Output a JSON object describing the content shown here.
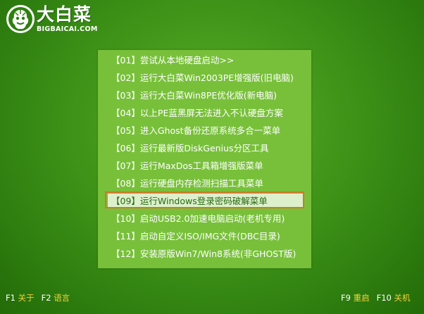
{
  "logo": {
    "name_cn": "大白菜",
    "name_en": "BIGBAICAI.COM",
    "icon": "cabbage-icon"
  },
  "menu": {
    "selected_index": 8,
    "items": [
      {
        "label": "【01】尝试从本地硬盘启动>>"
      },
      {
        "label": "【02】运行大白菜Win2003PE增强版(旧电脑)"
      },
      {
        "label": "【03】运行大白菜Win8PE优化版(新电脑)"
      },
      {
        "label": "【04】以上PE蓝黑屏无法进入不认硬盘方案"
      },
      {
        "label": "【05】进入Ghost备份还原系统多合一菜单"
      },
      {
        "label": "【06】运行最新版DiskGenius分区工具"
      },
      {
        "label": "【07】运行MaxDos工具箱增强版菜单"
      },
      {
        "label": "【08】运行硬盘内存检测扫描工具菜单"
      },
      {
        "label": "【09】运行Windows登录密码破解菜单"
      },
      {
        "label": "【10】启动USB2.0加速电脑启动(老机专用)"
      },
      {
        "label": "【11】启动自定义ISO/IMG文件(DBC目录)"
      },
      {
        "label": "【12】安装原版Win7/Win8系统(非GHOST版)"
      }
    ]
  },
  "footer": {
    "f1_key": "F1",
    "f1_label": "关于",
    "f2_key": "F2",
    "f2_label": "语言",
    "f9_key": "F9",
    "f9_label": "重启",
    "f10_key": "F10",
    "f10_label": "关机"
  },
  "colors": {
    "background": "#3f9418",
    "menu_bg": "#78c03a",
    "selected_bg": "#dcf0cc",
    "selected_border": "#d4762a",
    "footer_label": "#f3d13a"
  }
}
